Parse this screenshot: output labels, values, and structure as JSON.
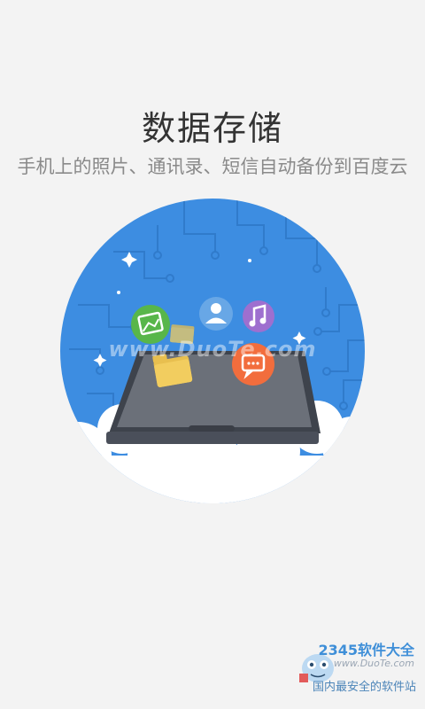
{
  "intro": {
    "title": "数据存储",
    "subtitle": "手机上的照片、通讯录、短信自动备份到百度云"
  },
  "illustration": {
    "circle_color": "#3d8de1",
    "circuit_color": "#2f79c9",
    "cloud_color": "#ffffff",
    "phone_body_color": "#4a4f5a",
    "phone_screen_color": "#6b7079",
    "folder_color": "#f2cd5f",
    "bubbles": [
      {
        "name": "gallery-icon",
        "color": "#58b64a"
      },
      {
        "name": "contact-icon",
        "color": "#68a7e6"
      },
      {
        "name": "music-icon",
        "color": "#9e6fcf"
      },
      {
        "name": "message-icon",
        "color": "#f26d3d"
      }
    ]
  },
  "watermark": {
    "text": "www.DuoTe.com"
  },
  "corner_logo": {
    "brand": "2345软件大全",
    "url": "www.DuoTe.com",
    "slogan": "国内最安全的软件站"
  }
}
